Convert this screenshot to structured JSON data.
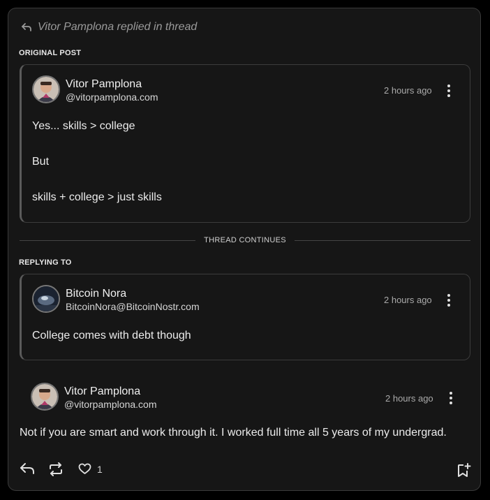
{
  "header": {
    "text": "Vitor Pamplona replied in thread"
  },
  "original_post": {
    "section_label": "ORIGINAL POST",
    "author": {
      "name": "Vitor Pamplona",
      "handle": "@vitorpamplona.com"
    },
    "time": "2 hours ago",
    "lines": [
      "Yes... skills > college",
      "But",
      "skills + college > just skills"
    ]
  },
  "divider": {
    "label": "THREAD CONTINUES"
  },
  "replying_to": {
    "section_label": "REPLYING TO",
    "author": {
      "name": "Bitcoin Nora",
      "handle": "BitcoinNora@BitcoinNostr.com"
    },
    "time": "2 hours ago",
    "text": "College comes with debt though"
  },
  "reply": {
    "author": {
      "name": "Vitor Pamplona",
      "handle": "@vitorpamplona.com"
    },
    "time": "2 hours ago",
    "text": "Not if you are smart and work through it. I worked full time all 5 years of my undergrad."
  },
  "actions": {
    "like_count": "1"
  },
  "colors": {
    "background": "#161616",
    "border": "#3a3a3a",
    "text": "#e6e6e6",
    "muted": "#9a9a9a"
  },
  "icons": [
    "reply-arrow-icon",
    "avatar",
    "more-vertical-icon",
    "repost-icon",
    "heart-icon",
    "bookmark-add-icon"
  ]
}
